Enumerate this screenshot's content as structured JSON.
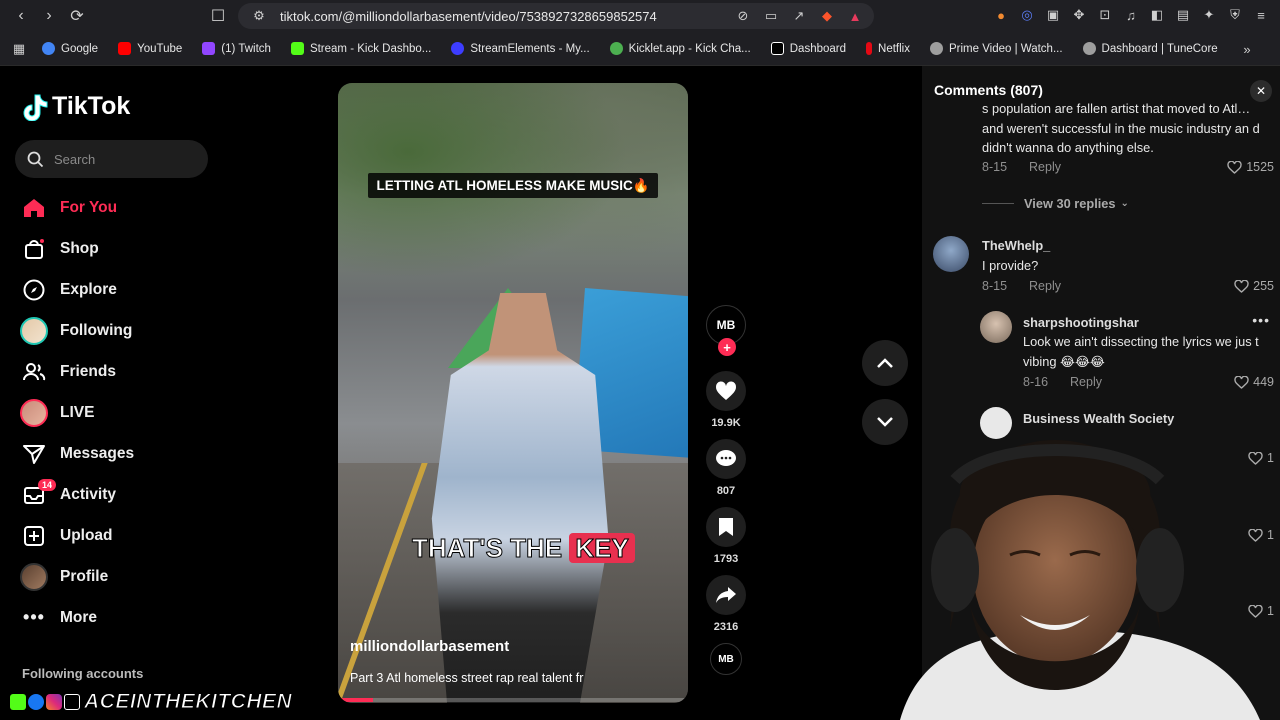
{
  "browser": {
    "url": "tiktok.com/@milliondollarbasement/video/7538927328659852574",
    "bookmarks": [
      {
        "label": "Google",
        "color": "#4285f4"
      },
      {
        "label": "YouTube",
        "color": "#ff0000"
      },
      {
        "label": "(1) Twitch",
        "color": "#9146ff"
      },
      {
        "label": "Stream - Kick Dashbo...",
        "color": "#53fc18"
      },
      {
        "label": "StreamElements - My...",
        "color": "#3d3dff"
      },
      {
        "label": "Kicklet.app - Kick Cha...",
        "color": "#4caf50"
      },
      {
        "label": "Dashboard",
        "color": "#ffffff"
      },
      {
        "label": "Netflix",
        "color": "#e50914"
      },
      {
        "label": "Prime Video | Watch...",
        "color": "#9e9e9e"
      },
      {
        "label": "Dashboard | TuneCore",
        "color": "#9e9e9e"
      }
    ]
  },
  "sidebar": {
    "logo": "TikTok",
    "search_placeholder": "Search",
    "items": [
      {
        "label": "For You",
        "icon": "home-icon"
      },
      {
        "label": "Shop",
        "icon": "shop-icon"
      },
      {
        "label": "Explore",
        "icon": "compass-icon"
      },
      {
        "label": "Following",
        "icon": "avatar-icon"
      },
      {
        "label": "Friends",
        "icon": "friends-icon"
      },
      {
        "label": "LIVE",
        "icon": "live-avatar-icon"
      },
      {
        "label": "Messages",
        "icon": "send-icon"
      },
      {
        "label": "Activity",
        "icon": "inbox-icon",
        "badge": "14"
      },
      {
        "label": "Upload",
        "icon": "plus-square-icon"
      },
      {
        "label": "Profile",
        "icon": "profile-icon"
      },
      {
        "label": "More",
        "icon": "more-icon"
      }
    ],
    "following_heading": "Following accounts"
  },
  "video": {
    "top_caption": "LETTING ATL HOMELESS MAKE MUSIC🔥",
    "caption_part1": "THAT'S THE",
    "caption_part2": "KEY",
    "author": "milliondollarbasement",
    "description": "Part 3 Atl homeless street rap real talent fr",
    "progress": 0.1
  },
  "actions": {
    "likes": "19.9K",
    "comments": "807",
    "saves": "1793",
    "shares": "2316"
  },
  "comments": {
    "title": "Comments (807)",
    "items": [
      {
        "text": "s population are fallen artist that moved to Atl… and weren't successful in the music industry an d didn't wanna do anything else.",
        "date": "8-15",
        "reply": "Reply",
        "likes": "1525"
      },
      {
        "view_replies": "View 30 replies"
      },
      {
        "user": "TheWhelp_",
        "text": "I provide?",
        "date": "8-15",
        "reply": "Reply",
        "likes": "255"
      },
      {
        "user": "sharpshootingshar",
        "text": "Look we ain't dissecting the lyrics we jus t vibing 😂😂😂",
        "date": "8-16",
        "reply": "Reply",
        "likes": "449"
      },
      {
        "user": "Business Wealth Society",
        "likes": "1"
      },
      {
        "likes": "1"
      },
      {
        "likes": "1"
      }
    ]
  },
  "overlay": {
    "streamer_tag": "ACEINTHEKITCHEN"
  }
}
